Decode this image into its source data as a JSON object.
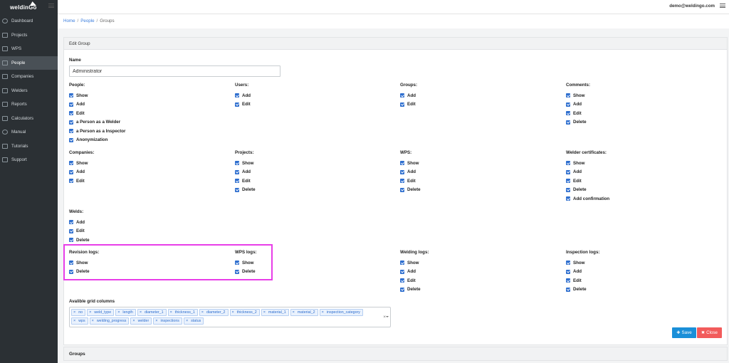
{
  "app": {
    "logo_text": "weldinGo"
  },
  "topbar": {
    "user_email": "demo@weldingo.com"
  },
  "sidebar": {
    "items": [
      {
        "label": "Dashboard",
        "icon": "dashboard-icon"
      },
      {
        "label": "Projects",
        "icon": "folder-icon"
      },
      {
        "label": "WPS",
        "icon": "document-icon"
      },
      {
        "label": "People",
        "icon": "people-icon",
        "active": true
      },
      {
        "label": "Companies",
        "icon": "handshake-icon"
      },
      {
        "label": "Welders",
        "icon": "welder-icon"
      },
      {
        "label": "Reports",
        "icon": "chart-icon"
      },
      {
        "label": "Calculators",
        "icon": "calculator-icon"
      },
      {
        "label": "Manual",
        "icon": "globe-icon"
      },
      {
        "label": "Tutorials",
        "icon": "video-icon"
      },
      {
        "label": "Support",
        "icon": "monitor-icon"
      }
    ]
  },
  "breadcrumb": {
    "home": "Home",
    "people": "People",
    "current": "Groups"
  },
  "card": {
    "title": "Edit Group",
    "name_label": "Name",
    "name_value": "Administrator"
  },
  "permissions": {
    "people": {
      "title": "People:",
      "items": [
        "Show",
        "Add",
        "Edit",
        "a Person as a Welder",
        "a Person as a Inspector",
        "Anonymization"
      ]
    },
    "users": {
      "title": "Users:",
      "items": [
        "Add",
        "Edit"
      ]
    },
    "groups": {
      "title": "Groups:",
      "items": [
        "Add",
        "Edit"
      ]
    },
    "comments": {
      "title": "Comments:",
      "items": [
        "Show",
        "Add",
        "Edit",
        "Delete"
      ]
    },
    "companies": {
      "title": "Companies:",
      "items": [
        "Show",
        "Add",
        "Edit"
      ]
    },
    "projects": {
      "title": "Projects:",
      "items": [
        "Show",
        "Add",
        "Edit",
        "Delete"
      ]
    },
    "wps": {
      "title": "WPS:",
      "items": [
        "Show",
        "Add",
        "Edit",
        "Delete"
      ]
    },
    "welder_certificates": {
      "title": "Welder certificates:",
      "items": [
        "Show",
        "Add",
        "Edit",
        "Delete",
        "Add confirmation"
      ]
    },
    "welds": {
      "title": "Welds:",
      "items": [
        "Add",
        "Edit",
        "Delete"
      ]
    },
    "revision_logs": {
      "title": "Revision logs:",
      "items": [
        "Show",
        "Delete"
      ]
    },
    "wps_logs": {
      "title": "WPS logs:",
      "items": [
        "Show",
        "Delete"
      ]
    },
    "welding_logs": {
      "title": "Welding logs:",
      "items": [
        "Show",
        "Add",
        "Edit",
        "Delete"
      ]
    },
    "inspection_logs": {
      "title": "Inspection logs:",
      "items": [
        "Show",
        "Add",
        "Edit",
        "Delete"
      ]
    }
  },
  "grid_columns": {
    "label": "Avalible grid columns",
    "tags": [
      "no",
      "weld_type",
      "length",
      "diameter_1",
      "thickness_1",
      "diameter_2",
      "thickness_2",
      "material_1",
      "material_2",
      "inspection_category",
      "wps",
      "welding_progress",
      "welder",
      "inspections",
      "status"
    ],
    "remove_glyph": "×",
    "clear_glyph": "×"
  },
  "buttons": {
    "save": "Save",
    "save_glyph": "✚",
    "close": "Close",
    "close_glyph": "✖"
  },
  "groups_section": {
    "title": "Groups"
  },
  "colors": {
    "checkbox": "#2f6fcf",
    "highlight": "#e83ee8",
    "save": "#1a8fd8",
    "close": "#f25b5b",
    "sidebar": "#2b3034"
  }
}
